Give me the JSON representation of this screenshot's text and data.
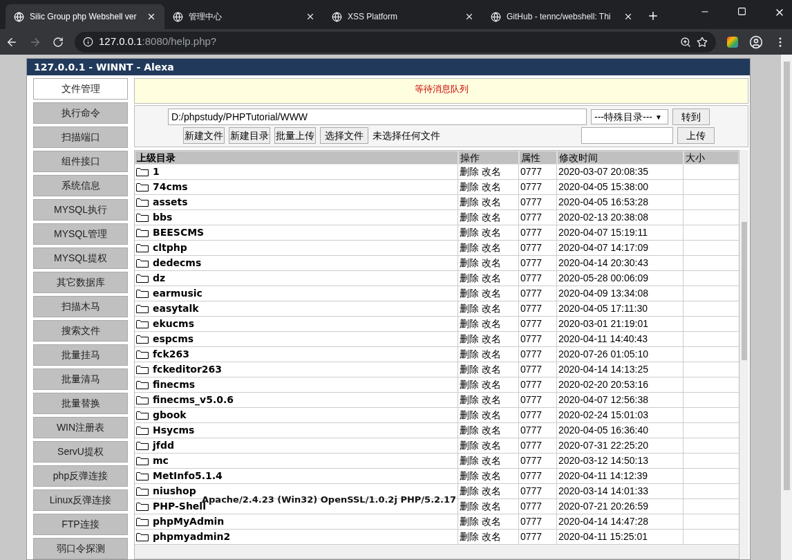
{
  "browser": {
    "tabs": [
      {
        "title": "Silic Group php Webshell ver",
        "selected": true
      },
      {
        "title": "管理中心",
        "selected": false
      },
      {
        "title": "XSS Platform",
        "selected": false
      },
      {
        "title": "GitHub - tennc/webshell: Thi",
        "selected": false
      }
    ],
    "url_host": "127.0.0.1",
    "url_rest": ":8080/help.php?"
  },
  "shell": {
    "title": "127.0.0.1 - WINNT - Alexa",
    "sidebar": [
      {
        "label": "文件管理",
        "selected": true
      },
      {
        "label": "执行命令",
        "selected": false
      },
      {
        "label": "扫描端口",
        "selected": false
      },
      {
        "label": "组件接口",
        "selected": false
      },
      {
        "label": "系统信息",
        "selected": false
      },
      {
        "label": "MYSQL执行",
        "selected": false
      },
      {
        "label": "MYSQL管理",
        "selected": false
      },
      {
        "label": "MYSQL提权",
        "selected": false
      },
      {
        "label": "其它数据库",
        "selected": false
      },
      {
        "label": "扫描木马",
        "selected": false
      },
      {
        "label": "搜索文件",
        "selected": false
      },
      {
        "label": "批量挂马",
        "selected": false
      },
      {
        "label": "批量清马",
        "selected": false
      },
      {
        "label": "批量替换",
        "selected": false
      },
      {
        "label": "WIN注册表",
        "selected": false
      },
      {
        "label": "ServU提权",
        "selected": false
      },
      {
        "label": "php反弹连接",
        "selected": false
      },
      {
        "label": "Linux反弹连接",
        "selected": false
      },
      {
        "label": "FTP连接",
        "selected": false
      },
      {
        "label": "弱口令探测",
        "selected": false
      }
    ],
    "message": "等待消息队列",
    "path": "D:/phpstudy/PHPTutorial/WWW",
    "special_dir": "---特殊目录---",
    "special_dir_caret": "▼",
    "go_button": "转到",
    "buttons": [
      "新建文件",
      "新建目录",
      "批量上传"
    ],
    "choose_file": "选择文件",
    "no_file": "未选择任何文件",
    "upload": "上传",
    "columns": [
      "上级目录",
      "操作",
      "属性",
      "修改时间",
      "大小"
    ],
    "rows": [
      {
        "name": "1",
        "delete": "删除",
        "rename": "改名",
        "perm": "0777",
        "time": "2020-03-07 20:08:35"
      },
      {
        "name": "74cms",
        "delete": "删除",
        "rename": "改名",
        "perm": "0777",
        "time": "2020-04-05 15:38:00"
      },
      {
        "name": "assets",
        "delete": "删除",
        "rename": "改名",
        "perm": "0777",
        "time": "2020-04-05 16:53:28"
      },
      {
        "name": "bbs",
        "delete": "删除",
        "rename": "改名",
        "perm": "0777",
        "time": "2020-02-13 20:38:08"
      },
      {
        "name": "BEESCMS",
        "delete": "删除",
        "rename": "改名",
        "perm": "0777",
        "time": "2020-04-07 15:19:11"
      },
      {
        "name": "cltphp",
        "delete": "删除",
        "rename": "改名",
        "perm": "0777",
        "time": "2020-04-07 14:17:09"
      },
      {
        "name": "dedecms",
        "delete": "删除",
        "rename": "改名",
        "perm": "0777",
        "time": "2020-04-14 20:30:43"
      },
      {
        "name": "dz",
        "delete": "删除",
        "rename": "改名",
        "perm": "0777",
        "time": "2020-05-28 00:06:09"
      },
      {
        "name": "earmusic",
        "delete": "删除",
        "rename": "改名",
        "perm": "0777",
        "time": "2020-04-09 13:34:08"
      },
      {
        "name": "easytalk",
        "delete": "删除",
        "rename": "改名",
        "perm": "0777",
        "time": "2020-04-05 17:11:30"
      },
      {
        "name": "ekucms",
        "delete": "删除",
        "rename": "改名",
        "perm": "0777",
        "time": "2020-03-01 21:19:01"
      },
      {
        "name": "espcms",
        "delete": "删除",
        "rename": "改名",
        "perm": "0777",
        "time": "2020-04-11 14:40:43"
      },
      {
        "name": "fck263",
        "delete": "删除",
        "rename": "改名",
        "perm": "0777",
        "time": "2020-07-26 01:05:10"
      },
      {
        "name": "fckeditor263",
        "delete": "删除",
        "rename": "改名",
        "perm": "0777",
        "time": "2020-04-14 14:13:25"
      },
      {
        "name": "finecms",
        "delete": "删除",
        "rename": "改名",
        "perm": "0777",
        "time": "2020-02-20 20:53:16"
      },
      {
        "name": "finecms_v5.0.6",
        "delete": "删除",
        "rename": "改名",
        "perm": "0777",
        "time": "2020-04-07 12:56:38"
      },
      {
        "name": "gbook",
        "delete": "删除",
        "rename": "改名",
        "perm": "0777",
        "time": "2020-02-24 15:01:03"
      },
      {
        "name": "Hsycms",
        "delete": "删除",
        "rename": "改名",
        "perm": "0777",
        "time": "2020-04-05 16:36:40"
      },
      {
        "name": "jfdd",
        "delete": "删除",
        "rename": "改名",
        "perm": "0777",
        "time": "2020-07-31 22:25:20"
      },
      {
        "name": "mc",
        "delete": "删除",
        "rename": "改名",
        "perm": "0777",
        "time": "2020-03-12 14:50:13"
      },
      {
        "name": "MetInfo5.1.4",
        "delete": "删除",
        "rename": "改名",
        "perm": "0777",
        "time": "2020-04-11 14:12:39"
      },
      {
        "name": "niushop",
        "delete": "删除",
        "rename": "改名",
        "perm": "0777",
        "time": "2020-03-14 14:01:33"
      },
      {
        "name": "PHP-Shell",
        "delete": "删除",
        "rename": "改名",
        "perm": "0777",
        "time": "2020-07-21 20:26:59"
      },
      {
        "name": "phpMyAdmin",
        "delete": "删除",
        "rename": "改名",
        "perm": "0777",
        "time": "2020-04-14 14:47:28"
      },
      {
        "name": "phpmyadmin2",
        "delete": "删除",
        "rename": "改名",
        "perm": "0777",
        "time": "2020-04-11 15:25:01"
      }
    ],
    "footer": "Apache/2.4.23 (Win32) OpenSSL/1.0.2j PHP/5.2.17"
  }
}
